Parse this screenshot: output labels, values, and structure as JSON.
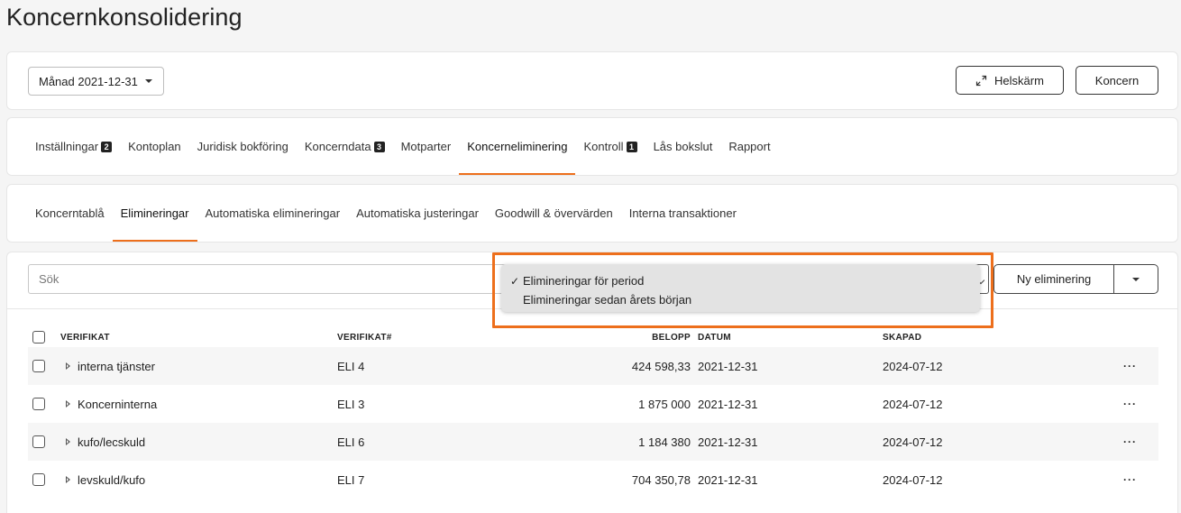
{
  "title": "Koncernkonsolidering",
  "top": {
    "period_label": "Månad 2021-12-31",
    "fullscreen_label": "Helskärm",
    "koncern_label": "Koncern"
  },
  "main_tabs": [
    {
      "label": "Inställningar",
      "badge": "2"
    },
    {
      "label": "Kontoplan",
      "badge": null
    },
    {
      "label": "Juridisk bokföring",
      "badge": null
    },
    {
      "label": "Koncerndata",
      "badge": "3"
    },
    {
      "label": "Motparter",
      "badge": null
    },
    {
      "label": "Koncerneliminering",
      "badge": null,
      "active": true
    },
    {
      "label": "Kontroll",
      "badge": "1"
    },
    {
      "label": "Lås bokslut",
      "badge": null
    },
    {
      "label": "Rapport",
      "badge": null
    }
  ],
  "sub_tabs": [
    {
      "label": "Koncerntablå"
    },
    {
      "label": "Elimineringar",
      "active": true
    },
    {
      "label": "Automatiska elimineringar"
    },
    {
      "label": "Automatiska justeringar"
    },
    {
      "label": "Goodwill & övervärden"
    },
    {
      "label": "Interna transaktioner"
    }
  ],
  "toolbar": {
    "search_placeholder": "Sök",
    "new_label": "Ny eliminering"
  },
  "dropdown": {
    "options": [
      {
        "label": "Elimineringar för period",
        "checked": true
      },
      {
        "label": "Elimineringar sedan årets början",
        "checked": false
      }
    ]
  },
  "table": {
    "headers": {
      "verifikat": "VERIFIKAT",
      "verifikat_nr": "VERIFIKAT#",
      "belopp": "BELOPP",
      "datum": "DATUM",
      "skapad": "SKAPAD"
    },
    "rows": [
      {
        "verifikat": "interna tjänster",
        "nr": "ELI 4",
        "belopp": "424 598,33",
        "datum": "2021-12-31",
        "skapad": "2024-07-12"
      },
      {
        "verifikat": "Koncerninterna",
        "nr": "ELI 3",
        "belopp": "1 875 000",
        "datum": "2021-12-31",
        "skapad": "2024-07-12"
      },
      {
        "verifikat": "kufo/lecskuld",
        "nr": "ELI 6",
        "belopp": "1 184 380",
        "datum": "2021-12-31",
        "skapad": "2024-07-12"
      },
      {
        "verifikat": "levskuld/kufo",
        "nr": "ELI 7",
        "belopp": "704 350,78",
        "datum": "2021-12-31",
        "skapad": "2024-07-12"
      }
    ],
    "row_menu": "···"
  },
  "colors": {
    "accent": "#ed6f1c",
    "badge": "#222222"
  }
}
